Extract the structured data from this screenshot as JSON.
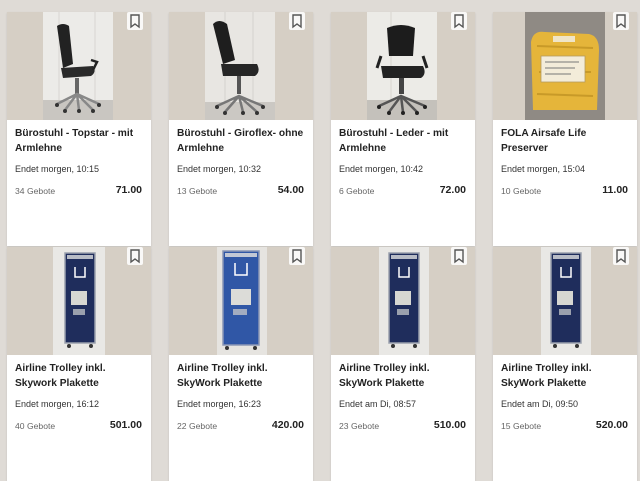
{
  "listings": [
    {
      "title": "Bürostuhl - Topstar - mit Armlehne",
      "ends": "Endet morgen, 10:15",
      "bids": "34 Gebote",
      "price": "71.00",
      "image": "office-chair-image"
    },
    {
      "title": "Bürostuhl - Giroflex- ohne Armlehne",
      "ends": "Endet morgen, 10:32",
      "bids": "13 Gebote",
      "price": "54.00",
      "image": "office-chair-image"
    },
    {
      "title": "Bürostuhl - Leder - mit Armlehne",
      "ends": "Endet morgen, 10:42",
      "bids": "6 Gebote",
      "price": "72.00",
      "image": "office-chair-image"
    },
    {
      "title": "FOLA Airsafe Life Preserver",
      "ends": "Endet morgen, 15:04",
      "bids": "10 Gebote",
      "price": "11.00",
      "image": "life-preserver-package-image"
    },
    {
      "title": "Airline Trolley inkl. Skywork Plakette",
      "ends": "Endet morgen, 16:12",
      "bids": "40 Gebote",
      "price": "501.00",
      "image": "airline-trolley-image"
    },
    {
      "title": "Airline Trolley inkl. SkyWork Plakette",
      "ends": "Endet morgen, 16:23",
      "bids": "22 Gebote",
      "price": "420.00",
      "image": "airline-trolley-image"
    },
    {
      "title": "Airline Trolley inkl. SkyWork Plakette",
      "ends": "Endet am Di, 08:57",
      "bids": "23 Gebote",
      "price": "510.00",
      "image": "airline-trolley-image"
    },
    {
      "title": "Airline Trolley inkl. SkyWork Plakette",
      "ends": "Endet am Di, 09:50",
      "bids": "15 Gebote",
      "price": "520.00",
      "image": "airline-trolley-image"
    }
  ],
  "icons": {
    "bookmark": "bookmark-icon"
  },
  "colors": {
    "background": "#dfdbd6",
    "card": "#ffffff",
    "trolley": "#1f2d5c",
    "life_preserver": "#e5b53a"
  }
}
